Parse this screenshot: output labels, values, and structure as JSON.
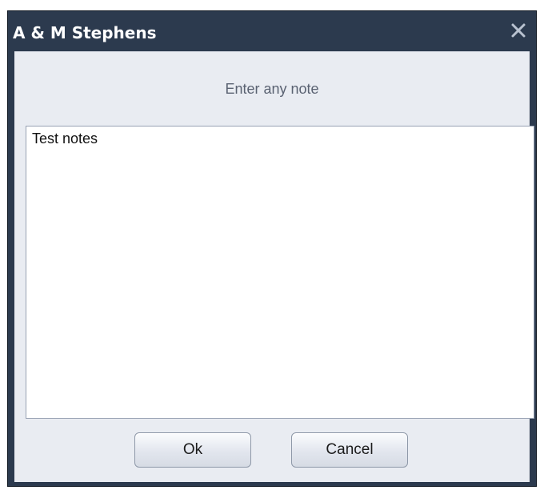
{
  "window": {
    "title": "A & M Stephens",
    "close_icon": "close-icon"
  },
  "dialog": {
    "prompt": "Enter any note",
    "note_value": "Test notes"
  },
  "buttons": {
    "ok_label": "Ok",
    "cancel_label": "Cancel"
  },
  "colors": {
    "titlebar": "#2c3a4e",
    "client_background": "#e9ecf2",
    "prompt_text": "#5a6272"
  }
}
